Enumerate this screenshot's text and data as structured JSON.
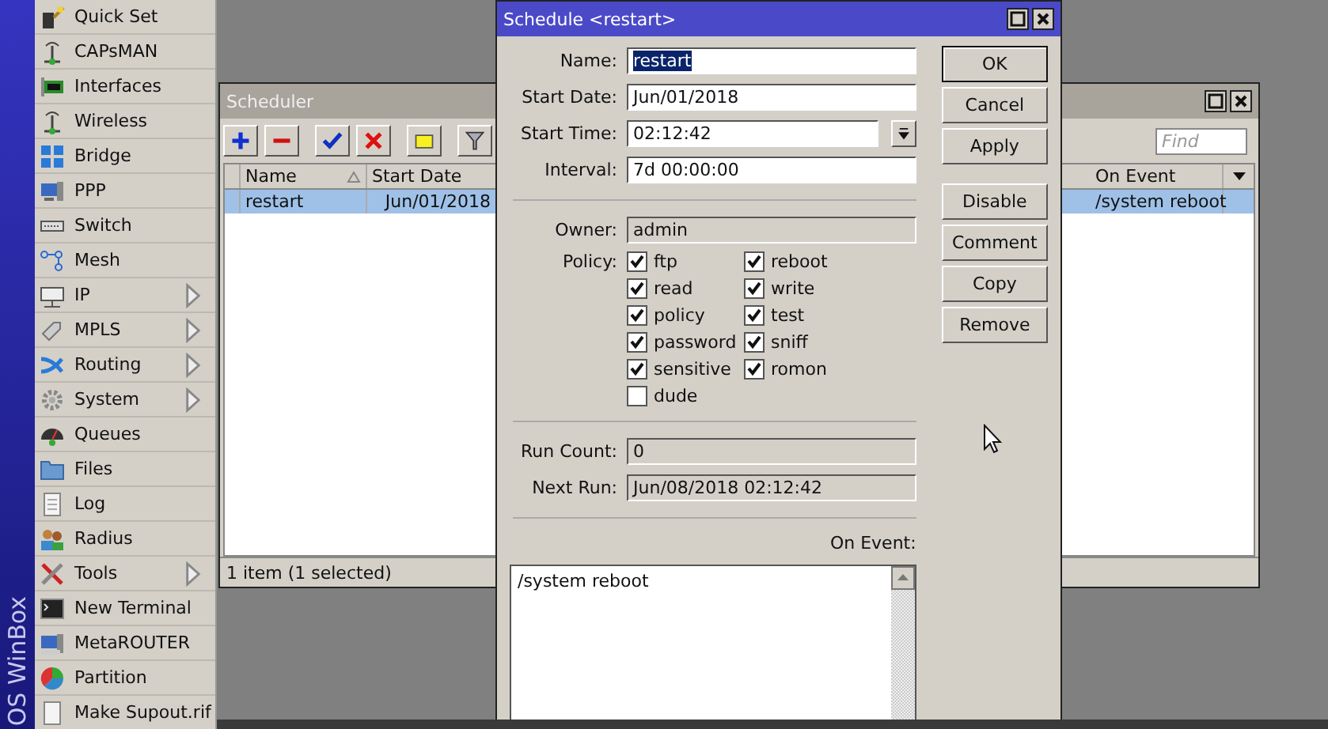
{
  "brand": {
    "text": "OS WinBox"
  },
  "sidebar": {
    "items": [
      {
        "label": "Quick Set",
        "has_submenu": false
      },
      {
        "label": "CAPsMAN",
        "has_submenu": false
      },
      {
        "label": "Interfaces",
        "has_submenu": false
      },
      {
        "label": "Wireless",
        "has_submenu": false
      },
      {
        "label": "Bridge",
        "has_submenu": false
      },
      {
        "label": "PPP",
        "has_submenu": false
      },
      {
        "label": "Switch",
        "has_submenu": false
      },
      {
        "label": "Mesh",
        "has_submenu": false
      },
      {
        "label": "IP",
        "has_submenu": true
      },
      {
        "label": "MPLS",
        "has_submenu": true
      },
      {
        "label": "Routing",
        "has_submenu": true
      },
      {
        "label": "System",
        "has_submenu": true
      },
      {
        "label": "Queues",
        "has_submenu": false
      },
      {
        "label": "Files",
        "has_submenu": false
      },
      {
        "label": "Log",
        "has_submenu": false
      },
      {
        "label": "Radius",
        "has_submenu": false
      },
      {
        "label": "Tools",
        "has_submenu": true
      },
      {
        "label": "New Terminal",
        "has_submenu": false
      },
      {
        "label": "MetaROUTER",
        "has_submenu": false
      },
      {
        "label": "Partition",
        "has_submenu": false
      },
      {
        "label": "Make Supout.rif",
        "has_submenu": false
      }
    ]
  },
  "scheduler": {
    "title": "Scheduler",
    "find": {
      "placeholder": "Find"
    },
    "columns_left": [
      {
        "label": "Name",
        "sorted": true
      },
      {
        "label": "Start Date",
        "sorted": false
      }
    ],
    "columns_right": [
      {
        "label": "On Event",
        "sorted": false
      }
    ],
    "rows": [
      {
        "selected": true,
        "cells_left": [
          "restart",
          "Jun/01/2018"
        ],
        "cells_right": [
          "/system reboot"
        ]
      }
    ],
    "status": "1 item (1 selected)"
  },
  "dialog": {
    "title": "Schedule <restart>",
    "fields": [
      {
        "label": "Name:",
        "value": "restart",
        "text_selected": true,
        "dropdown": false
      },
      {
        "label": "Start Date:",
        "value": "Jun/01/2018",
        "text_selected": false,
        "dropdown": false
      },
      {
        "label": "Start Time:",
        "value": "02:12:42",
        "text_selected": false,
        "dropdown": true
      },
      {
        "label": "Interval:",
        "value": "7d 00:00:00",
        "text_selected": false,
        "dropdown": false
      }
    ],
    "owner": {
      "label": "Owner:",
      "value": "admin"
    },
    "policy": {
      "label": "Policy:",
      "columns": [
        [
          {
            "label": "ftp",
            "checked": true
          },
          {
            "label": "read",
            "checked": true
          },
          {
            "label": "policy",
            "checked": true
          },
          {
            "label": "password",
            "checked": true
          },
          {
            "label": "sensitive",
            "checked": true
          },
          {
            "label": "dude",
            "checked": false
          }
        ],
        [
          {
            "label": "reboot",
            "checked": true
          },
          {
            "label": "write",
            "checked": true
          },
          {
            "label": "test",
            "checked": true
          },
          {
            "label": "sniff",
            "checked": true
          },
          {
            "label": "romon",
            "checked": true
          }
        ]
      ]
    },
    "status_fields": [
      {
        "label": "Run Count:",
        "value": "0"
      },
      {
        "label": "Next Run:",
        "value": "Jun/08/2018 02:12:42"
      }
    ],
    "on_event": {
      "label": "On Event:",
      "text": "/system reboot"
    },
    "buttons": [
      {
        "label": "OK",
        "default": true
      },
      {
        "label": "Cancel",
        "default": false
      },
      {
        "label": "Apply",
        "default": false
      },
      {
        "label": "Disable",
        "default": false
      },
      {
        "label": "Comment",
        "default": false
      },
      {
        "label": "Copy",
        "default": false
      },
      {
        "label": "Remove",
        "default": false
      }
    ]
  }
}
